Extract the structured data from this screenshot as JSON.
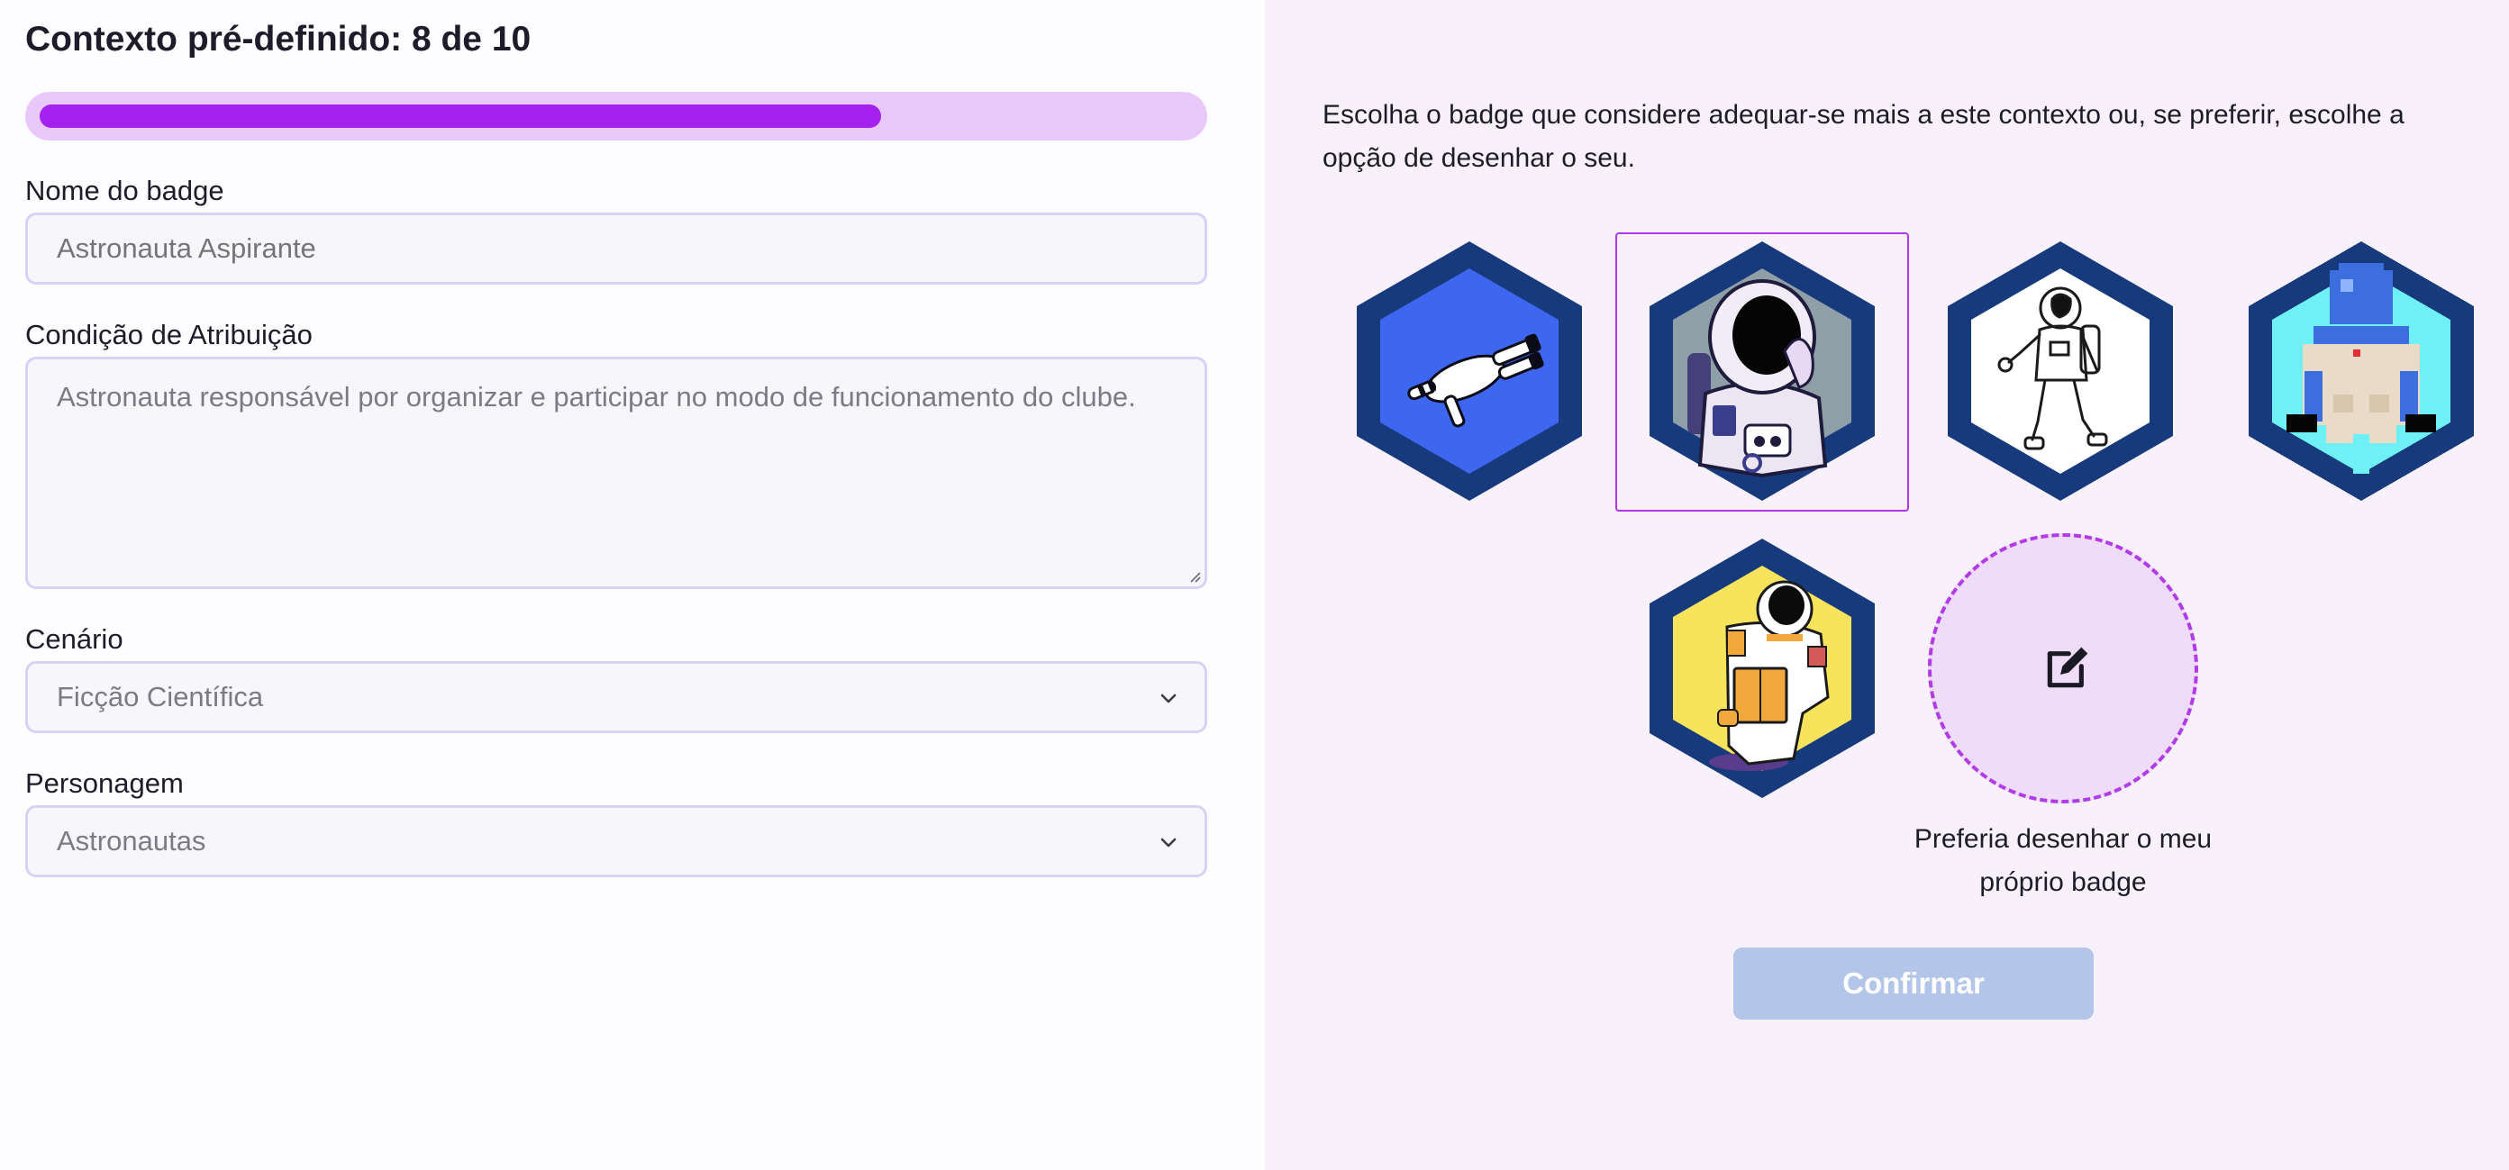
{
  "header": {
    "context_title": "Contexto pré-definido: 8 de 10",
    "progress": 0.73,
    "progress_color": "#a421ee",
    "track_color": "#e8c8fb"
  },
  "form": {
    "name_label": "Nome do badge",
    "name_value": "Astronauta Aspirante",
    "condition_label": "Condição de Atribuição",
    "condition_value": "Astronauta responsável por organizar e participar no modo de funcionamento do clube.",
    "scenario_label": "Cenário",
    "scenario_value": "Ficção Científica",
    "character_label": "Personagem",
    "character_value": "Astronautas"
  },
  "picker": {
    "intro": "Escolha o badge que considere adequar-se mais a este contexto ou, se preferir, escolhe a opção de desenhar o seu.",
    "badges": [
      {
        "icon": "floating-astronaut-icon",
        "background": "#3d67f0"
      },
      {
        "icon": "astronaut-helmet-icon",
        "background": "#8f9fa8",
        "selected": true
      },
      {
        "icon": "astronaut-sketch-icon",
        "background": "#ffffff"
      },
      {
        "icon": "pixel-astronaut-icon",
        "background": "#6ff0f4"
      },
      {
        "icon": "astronaut-clipboard-icon",
        "background": "#f7e45c"
      }
    ],
    "draw_option": "Preferia desenhar o meu próprio badge",
    "draw_icon": "edit-icon",
    "confirm_label": "Confirmar",
    "hex_border_color": "#173a7c"
  }
}
